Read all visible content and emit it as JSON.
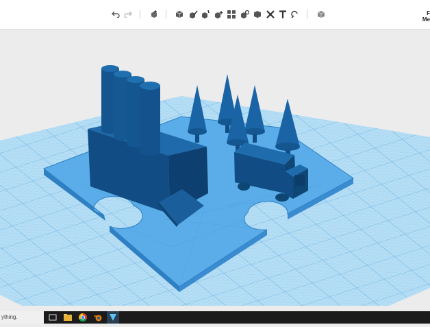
{
  "toolbar": {
    "corner_text_line1": "F",
    "corner_text_line2": "Me",
    "icons": [
      "undo-icon",
      "redo-icon",
      "add-shape-icon",
      "box-icon",
      "sketch-icon",
      "construct-icon",
      "modify-icon",
      "pattern-icon",
      "group-icon",
      "boolean-icon",
      "measure-icon",
      "text-icon",
      "snap-icon",
      "material-icon"
    ]
  },
  "taskbar": {
    "search_text": "ything.",
    "icons": [
      "task-view-icon",
      "file-explorer-icon",
      "chrome-icon",
      "blender-icon",
      "meshmixer-icon"
    ]
  },
  "colors": {
    "grid_plate": "#a9d9f3",
    "model_top": "#5aace6",
    "model_side": "#1a5a93",
    "dark_blue": "#0e4674"
  }
}
